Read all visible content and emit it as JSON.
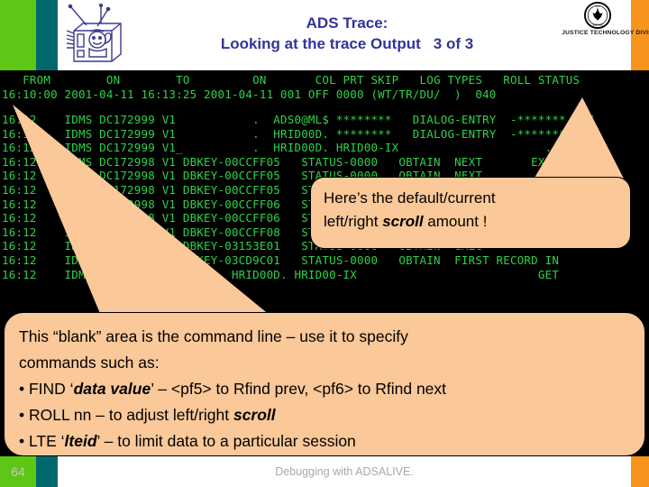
{
  "header": {
    "title_line1": "ADS Trace:",
    "title_line2": "Looking at the trace Output",
    "page_indicator": "3 of 3",
    "logo_caption": "JUSTICE TECHNOLOGY DIVISION",
    "tv_icon_name": "tv-cartoon-icon",
    "seal_icon_name": "eagle-seal-icon",
    "colors": {
      "title": "#333399",
      "green_bar": "#5ec614",
      "teal_bar": "#00696e",
      "orange_bar": "#f7941e"
    }
  },
  "terminal": {
    "colors": {
      "background": "#000000",
      "text": "#2fd14a"
    },
    "header_row": "   FROM        ON        TO         ON       COL PRT SKIP   LOG TYPES   ROLL STATUS",
    "status_row": "16:10:00 2001-04-11 16:13:25 2001-04-11 001 OFF 0000 (WT/TR/DU/  )  040",
    "rows": [
      "16:12    IDMS DC172999 V1           .  ADS0@ML$ ********   DIALOG-ENTRY  -******* *-Y",
      "16:12    IDMS DC172999 V1           .  HRID00D. ********   DIALOG-ENTRY  -******* *-Y",
      "16:12    IDMS DC172999 V1_          .  HRID00D. HRID00-IX                     .  *-Y",
      "16:12    IDMS DC172998 V1 DBKEY-00CCFF05   STATUS-0000   OBTAIN  NEXT       EXI",
      "16:12    IDMS DC172998 V1 DBKEY-00CCFF05   STATUS-0000   OBTAIN  NEXT         L",
      "16:12    IDMS DC172998 V1 DBKEY-00CCFF05   STATUS-0000   OBTAIN  NEXT         L",
      "16:12    IDMS DC172998 V1 DBKEY-00CCFF06   STATUS-0000   OBTAIN  NEXT         L",
      "16:12    IDMS DC172998 V1 DBKEY-00CCFF06   STATUS-0000   OBTAIN  NEXT",
      "16:12    IDMS DC172998 V1 DBKEY-00CCFF08   STATUS-0000   BIND    RECORD",
      "16:12    IDMS DC172998 V1 DBKEY-03153E01   STATUS-0000   OBTAIN  CALC",
      "16:12    IDMS DC172998 V1 DBKEY-03CD9C01   STATUS-0000   OBTAIN  FIRST RECORD IN",
      "16:12    IDMS DC172998 V1        HRID00D. HRID00-IX                          GET"
    ]
  },
  "callouts": {
    "scroll": {
      "name": "scroll-amount-callout",
      "line1_pre": "Here’s the default/current",
      "line2_pre": "left/right ",
      "line2_emph": "scroll",
      "line2_post": " amount !",
      "fill_color": "#fac899"
    },
    "command_line": {
      "name": "command-line-callout",
      "line1": "This “blank” area is the command line – use it to specify",
      "line2": "commands such as:",
      "bullets": [
        {
          "pre": "• FIND ‘",
          "emph": "data value",
          "post": "’ – <pf5> to Rfind prev, <pf6> to Rfind next"
        },
        {
          "pre": "• ROLL nn – to adjust left/right ",
          "emph": "scroll",
          "post": ""
        },
        {
          "pre": "• LTE ‘",
          "emph": "lteid",
          "post": "’ – to limit data to a particular session"
        }
      ],
      "fill_color": "#fac899"
    }
  },
  "footer": {
    "slide_number": "64",
    "caption": "Debugging with ADSALIVE."
  }
}
